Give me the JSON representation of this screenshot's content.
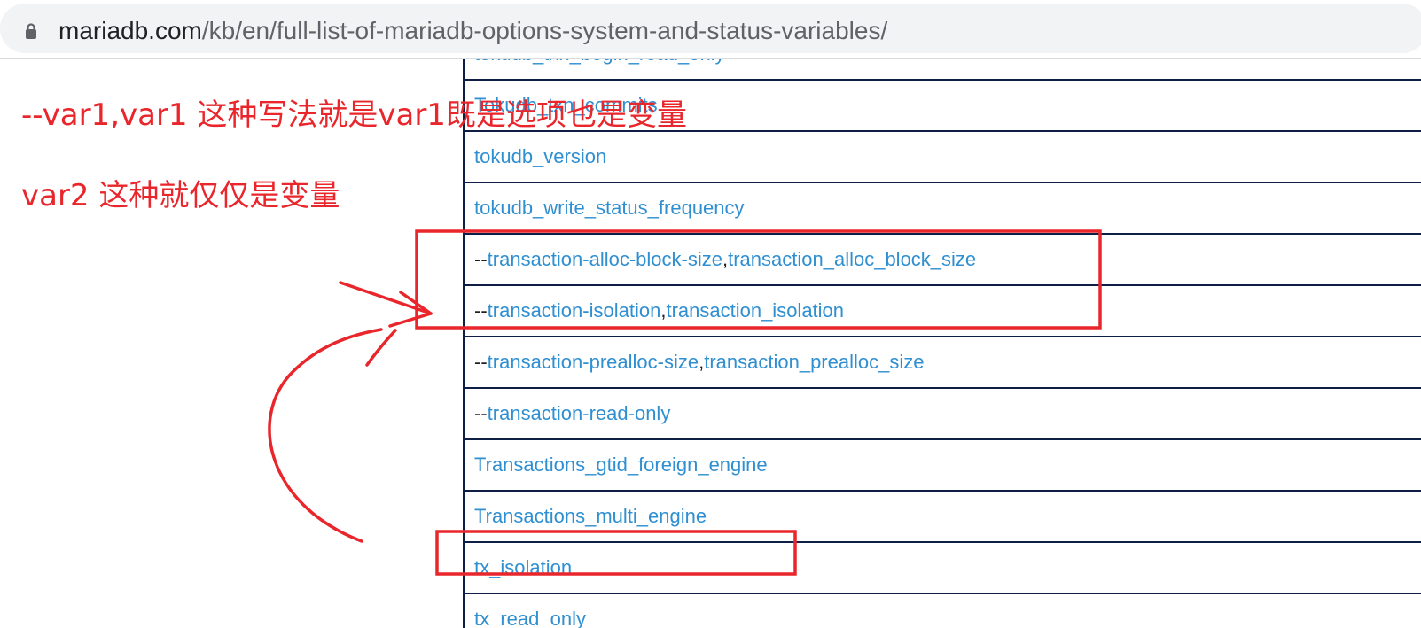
{
  "browser": {
    "url_host": "mariadb.com",
    "url_path": "/kb/en/full-list-of-mariadb-options-system-and-status-variables/",
    "lock_icon": "lock-icon"
  },
  "annotations": {
    "note_line1": "--var1,var1   这种写法就是var1既是选项也是变量",
    "note_line2": "var2 这种就仅仅是变量"
  },
  "rows": [
    {
      "prefix": "",
      "option": "tokudb_txn_begin_read_only",
      "sep": "",
      "variable": ""
    },
    {
      "prefix": "",
      "option": "Tokudb_txn_commits",
      "sep": "",
      "variable": ""
    },
    {
      "prefix": "",
      "option": "tokudb_version",
      "sep": "",
      "variable": ""
    },
    {
      "prefix": "",
      "option": "tokudb_write_status_frequency",
      "sep": "",
      "variable": ""
    },
    {
      "prefix": "--",
      "option": "transaction-alloc-block-size",
      "sep": ", ",
      "variable": "transaction_alloc_block_size"
    },
    {
      "prefix": "--",
      "option": "transaction-isolation",
      "sep": ", ",
      "variable": "transaction_isolation"
    },
    {
      "prefix": "--",
      "option": "transaction-prealloc-size",
      "sep": ", ",
      "variable": "transaction_prealloc_size"
    },
    {
      "prefix": "--",
      "option": "transaction-read-only",
      "sep": "",
      "variable": ""
    },
    {
      "prefix": "",
      "option": "Transactions_gtid_foreign_engine",
      "sep": "",
      "variable": ""
    },
    {
      "prefix": "",
      "option": "Transactions_multi_engine",
      "sep": "",
      "variable": ""
    },
    {
      "prefix": "",
      "option": "tx_isolation",
      "sep": "",
      "variable": ""
    },
    {
      "prefix": "",
      "option": "tx_read_only",
      "sep": "",
      "variable": ""
    }
  ]
}
